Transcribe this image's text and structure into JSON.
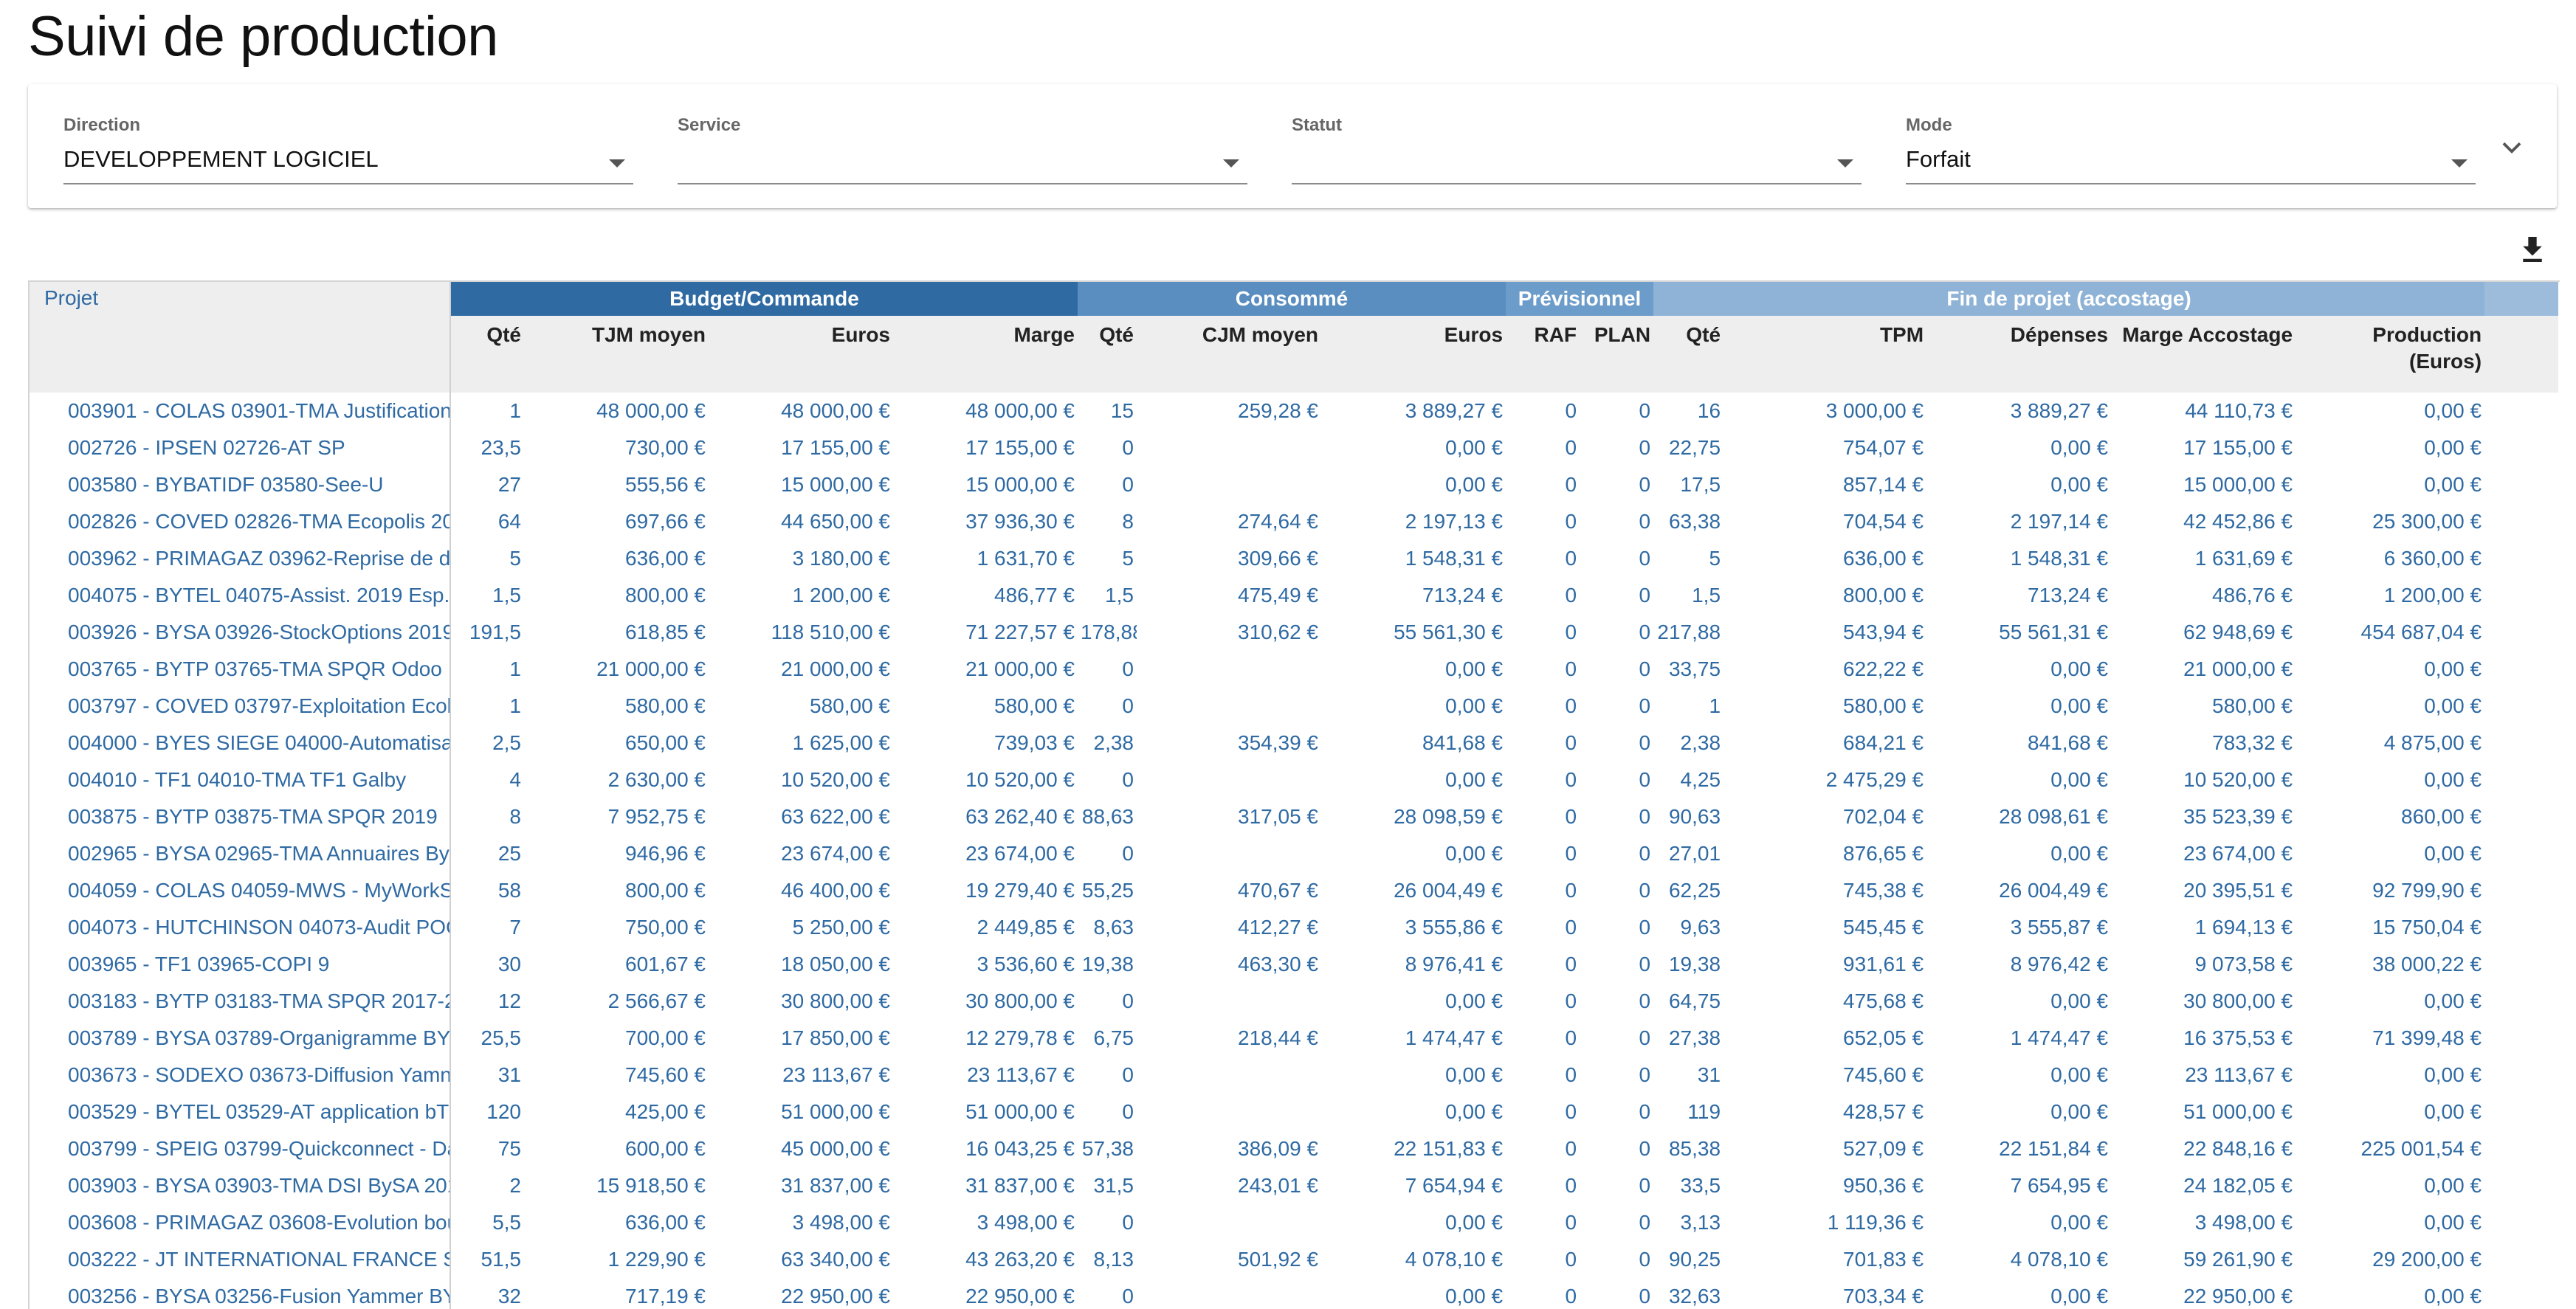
{
  "page": {
    "title": "Suivi de production"
  },
  "filters": [
    {
      "label": "Direction",
      "value": "DEVELOPPEMENT LOGICIEL"
    },
    {
      "label": "Service",
      "value": ""
    },
    {
      "label": "Statut",
      "value": ""
    },
    {
      "label": "Mode",
      "value": "Forfait"
    }
  ],
  "icons": {
    "expand": "chevron-down-icon",
    "download": "download-icon",
    "dropdown": "caret-down-icon"
  },
  "colors": {
    "budget": "#2f6aa3",
    "consomme": "#5b8ec0",
    "previsionnel": "#6c9cc9",
    "fin": "#8fb3d6",
    "link": "#2f6aa3"
  },
  "table": {
    "projet_header": "Projet",
    "groups": [
      "Budget/Commande",
      "Consommé",
      "Prévisionnel",
      "Fin de projet (accostage)"
    ],
    "columns": [
      "Qté",
      "TJM moyen",
      "Euros",
      "Marge",
      "Qté",
      "CJM moyen",
      "Euros",
      "RAF",
      "PLAN",
      "Qté",
      "TPM",
      "Dépenses",
      "Marge Accostage",
      "Production (Euros)"
    ],
    "rows": [
      [
        "003901 - COLAS 03901-TMA Justification",
        "1",
        "48 000,00 €",
        "48 000,00 €",
        "48 000,00 €",
        "15",
        "259,28 €",
        "3 889,27 €",
        "0",
        "0",
        "16",
        "3 000,00 €",
        "3 889,27 €",
        "44 110,73 €",
        "0,00 €"
      ],
      [
        "002726 - IPSEN 02726-AT SP",
        "23,5",
        "730,00 €",
        "17 155,00 €",
        "17 155,00 €",
        "0",
        "",
        "0,00 €",
        "0",
        "0",
        "22,75",
        "754,07 €",
        "0,00 €",
        "17 155,00 €",
        "0,00 €"
      ],
      [
        "003580 - BYBATIDF 03580-See-U",
        "27",
        "555,56 €",
        "15 000,00 €",
        "15 000,00 €",
        "0",
        "",
        "0,00 €",
        "0",
        "0",
        "17,5",
        "857,14 €",
        "0,00 €",
        "15 000,00 €",
        "0,00 €"
      ],
      [
        "002826 - COVED 02826-TMA Ecopolis 20",
        "64",
        "697,66 €",
        "44 650,00 €",
        "37 936,30 €",
        "8",
        "274,64 €",
        "2 197,13 €",
        "0",
        "0",
        "63,38",
        "704,54 €",
        "2 197,14 €",
        "42 452,86 €",
        "25 300,00 €"
      ],
      [
        "003962 - PRIMAGAZ 03962-Reprise de d",
        "5",
        "636,00 €",
        "3 180,00 €",
        "1 631,70 €",
        "5",
        "309,66 €",
        "1 548,31 €",
        "0",
        "0",
        "5",
        "636,00 €",
        "1 548,31 €",
        "1 631,69 €",
        "6 360,00 €"
      ],
      [
        "004075 - BYTEL 04075-Assist. 2019 Esp.",
        "1,5",
        "800,00 €",
        "1 200,00 €",
        "486,77 €",
        "1,5",
        "475,49 €",
        "713,24 €",
        "0",
        "0",
        "1,5",
        "800,00 €",
        "713,24 €",
        "486,76 €",
        "1 200,00 €"
      ],
      [
        "003926 - BYSA 03926-StockOptions 2019",
        "191,5",
        "618,85 €",
        "118 510,00 €",
        "71 227,57 €",
        "178,88",
        "310,62 €",
        "55 561,30 €",
        "0",
        "0",
        "217,88",
        "543,94 €",
        "55 561,31 €",
        "62 948,69 €",
        "454 687,04 €"
      ],
      [
        "003765 - BYTP 03765-TMA SPQR Odoo",
        "1",
        "21 000,00 €",
        "21 000,00 €",
        "21 000,00 €",
        "0",
        "",
        "0,00 €",
        "0",
        "0",
        "33,75",
        "622,22 €",
        "0,00 €",
        "21 000,00 €",
        "0,00 €"
      ],
      [
        "003797 - COVED 03797-Exploitation Ecol",
        "1",
        "580,00 €",
        "580,00 €",
        "580,00 €",
        "0",
        "",
        "0,00 €",
        "0",
        "0",
        "1",
        "580,00 €",
        "0,00 €",
        "580,00 €",
        "0,00 €"
      ],
      [
        "004000 - BYES SIEGE 04000-Automatisa",
        "2,5",
        "650,00 €",
        "1 625,00 €",
        "739,03 €",
        "2,38",
        "354,39 €",
        "841,68 €",
        "0",
        "0",
        "2,38",
        "684,21 €",
        "841,68 €",
        "783,32 €",
        "4 875,00 €"
      ],
      [
        "004010 - TF1 04010-TMA TF1 Galby",
        "4",
        "2 630,00 €",
        "10 520,00 €",
        "10 520,00 €",
        "0",
        "",
        "0,00 €",
        "0",
        "0",
        "4,25",
        "2 475,29 €",
        "0,00 €",
        "10 520,00 €",
        "0,00 €"
      ],
      [
        "003875 - BYTP 03875-TMA SPQR 2019",
        "8",
        "7 952,75 €",
        "63 622,00 €",
        "63 262,40 €",
        "88,63",
        "317,05 €",
        "28 098,59 €",
        "0",
        "0",
        "90,63",
        "702,04 €",
        "28 098,61 €",
        "35 523,39 €",
        "860,00 €"
      ],
      [
        "002965 - BYSA 02965-TMA Annuaires By",
        "25",
        "946,96 €",
        "23 674,00 €",
        "23 674,00 €",
        "0",
        "",
        "0,00 €",
        "0",
        "0",
        "27,01",
        "876,65 €",
        "0,00 €",
        "23 674,00 €",
        "0,00 €"
      ],
      [
        "004059 - COLAS 04059-MWS - MyWorkS",
        "58",
        "800,00 €",
        "46 400,00 €",
        "19 279,40 €",
        "55,25",
        "470,67 €",
        "26 004,49 €",
        "0",
        "0",
        "62,25",
        "745,38 €",
        "26 004,49 €",
        "20 395,51 €",
        "92 799,90 €"
      ],
      [
        "004073 - HUTCHINSON 04073-Audit POC",
        "7",
        "750,00 €",
        "5 250,00 €",
        "2 449,85 €",
        "8,63",
        "412,27 €",
        "3 555,86 €",
        "0",
        "0",
        "9,63",
        "545,45 €",
        "3 555,87 €",
        "1 694,13 €",
        "15 750,04 €"
      ],
      [
        "003965 - TF1 03965-COPI 9",
        "30",
        "601,67 €",
        "18 050,00 €",
        "3 536,60 €",
        "19,38",
        "463,30 €",
        "8 976,41 €",
        "0",
        "0",
        "19,38",
        "931,61 €",
        "8 976,42 €",
        "9 073,58 €",
        "38 000,22 €"
      ],
      [
        "003183 - BYTP 03183-TMA SPQR 2017-2",
        "12",
        "2 566,67 €",
        "30 800,00 €",
        "30 800,00 €",
        "0",
        "",
        "0,00 €",
        "0",
        "0",
        "64,75",
        "475,68 €",
        "0,00 €",
        "30 800,00 €",
        "0,00 €"
      ],
      [
        "003789 - BYSA 03789-Organigramme BY",
        "25,5",
        "700,00 €",
        "17 850,00 €",
        "12 279,78 €",
        "6,75",
        "218,44 €",
        "1 474,47 €",
        "0",
        "0",
        "27,38",
        "652,05 €",
        "1 474,47 €",
        "16 375,53 €",
        "71 399,48 €"
      ],
      [
        "003673 - SODEXO 03673-Diffusion Yamn",
        "31",
        "745,60 €",
        "23 113,67 €",
        "23 113,67 €",
        "0",
        "",
        "0,00 €",
        "0",
        "0",
        "31",
        "745,60 €",
        "0,00 €",
        "23 113,67 €",
        "0,00 €"
      ],
      [
        "003529 - BYTEL 03529-AT application bT",
        "120",
        "425,00 €",
        "51 000,00 €",
        "51 000,00 €",
        "0",
        "",
        "0,00 €",
        "0",
        "0",
        "119",
        "428,57 €",
        "0,00 €",
        "51 000,00 €",
        "0,00 €"
      ],
      [
        "003799 - SPEIG 03799-Quickconnect - Da",
        "75",
        "600,00 €",
        "45 000,00 €",
        "16 043,25 €",
        "57,38",
        "386,09 €",
        "22 151,83 €",
        "0",
        "0",
        "85,38",
        "527,09 €",
        "22 151,84 €",
        "22 848,16 €",
        "225 001,54 €"
      ],
      [
        "003903 - BYSA 03903-TMA DSI BySA 201",
        "2",
        "15 918,50 €",
        "31 837,00 €",
        "31 837,00 €",
        "31,5",
        "243,01 €",
        "7 654,94 €",
        "0",
        "0",
        "33,5",
        "950,36 €",
        "7 654,95 €",
        "24 182,05 €",
        "0,00 €"
      ],
      [
        "003608 - PRIMAGAZ 03608-Evolution bou",
        "5,5",
        "636,00 €",
        "3 498,00 €",
        "3 498,00 €",
        "0",
        "",
        "0,00 €",
        "0",
        "0",
        "3,13",
        "1 119,36 €",
        "0,00 €",
        "3 498,00 €",
        "0,00 €"
      ],
      [
        "003222 - JT INTERNATIONAL FRANCE S",
        "51,5",
        "1 229,90 €",
        "63 340,00 €",
        "43 263,20 €",
        "8,13",
        "501,92 €",
        "4 078,10 €",
        "0",
        "0",
        "90,25",
        "701,83 €",
        "4 078,10 €",
        "59 261,90 €",
        "29 200,00 €"
      ],
      [
        "003256 - BYSA 03256-Fusion Yammer BY",
        "32",
        "717,19 €",
        "22 950,00 €",
        "22 950,00 €",
        "0",
        "",
        "0,00 €",
        "0",
        "0",
        "32,63",
        "703,34 €",
        "0,00 €",
        "22 950,00 €",
        "0,00 €"
      ]
    ]
  }
}
